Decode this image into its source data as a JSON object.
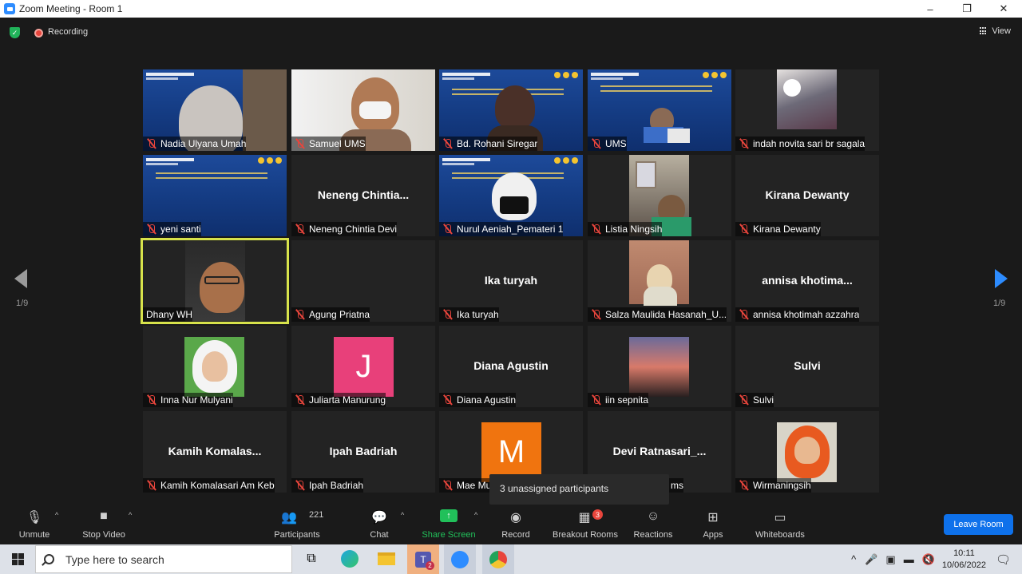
{
  "window": {
    "title": "Zoom Meeting - Room 1",
    "minimize": "–",
    "restore": "❐",
    "close": "✕"
  },
  "meeting": {
    "recording_label": "Recording",
    "view_label": "View",
    "page_left": "1/9",
    "page_right": "1/9",
    "tooltip": "3 unassigned participants"
  },
  "tiles": [
    {
      "label": "Nadia Ulyana Umah",
      "big": ""
    },
    {
      "label": "Samuel UMS",
      "big": ""
    },
    {
      "label": "Bd. Rohani Siregar",
      "big": ""
    },
    {
      "label": "UMS",
      "big": ""
    },
    {
      "label": "indah novita sari br sagala",
      "big": ""
    },
    {
      "label": "yeni santi",
      "big": ""
    },
    {
      "label": "Neneng Chintia Devi",
      "big": "Neneng  Chintia..."
    },
    {
      "label": "Nurul Aeniah_Pemateri 1",
      "big": ""
    },
    {
      "label": "Listia Ningsih",
      "big": ""
    },
    {
      "label": "Kirana Dewanty",
      "big": "Kirana Dewanty"
    },
    {
      "label": "Dhany WH",
      "big": ""
    },
    {
      "label": "Agung Priatna",
      "big": ""
    },
    {
      "label": "Ika turyah",
      "big": "Ika turyah"
    },
    {
      "label": "Salza Maulida Hasanah_U...",
      "big": ""
    },
    {
      "label": "annisa khotimah azzahra",
      "big": "annisa  khotima..."
    },
    {
      "label": "Inna Nur Mulyani",
      "big": ""
    },
    {
      "label": "Juliarta Manurung",
      "big": "",
      "avatar": "J"
    },
    {
      "label": "Diana Agustin",
      "big": "Diana Agustin"
    },
    {
      "label": "iin sepnita",
      "big": ""
    },
    {
      "label": "Sulvi",
      "big": "Sulvi"
    },
    {
      "label": "Kamih Komalasari Am Keb",
      "big": "Kamih  Komalas..."
    },
    {
      "label": "Ipah Badriah",
      "big": "Ipah Badriah"
    },
    {
      "label": "Mae Mu",
      "big": "",
      "avatar": "M"
    },
    {
      "label": "ms",
      "big": "Devi  Ratnasari_..."
    },
    {
      "label": "Wirmaningsih",
      "big": ""
    }
  ],
  "toolbar": {
    "unmute": "Unmute",
    "stop_video": "Stop Video",
    "participants": "Participants",
    "participants_count": "221",
    "chat": "Chat",
    "share_screen": "Share Screen",
    "record": "Record",
    "breakout_rooms": "Breakout Rooms",
    "breakout_badge": "3",
    "reactions": "Reactions",
    "apps": "Apps",
    "whiteboards": "Whiteboards",
    "leave_room": "Leave Room"
  },
  "taskbar": {
    "search_placeholder": "Type here to search",
    "time": "10:11",
    "date": "10/06/2022",
    "teams_badge": "2"
  },
  "colors": {
    "accent": "#2d8cff",
    "leave": "#0e71eb",
    "mute": "#e8453c",
    "share": "#21c05a",
    "active_speaker": "#d7e24b"
  }
}
